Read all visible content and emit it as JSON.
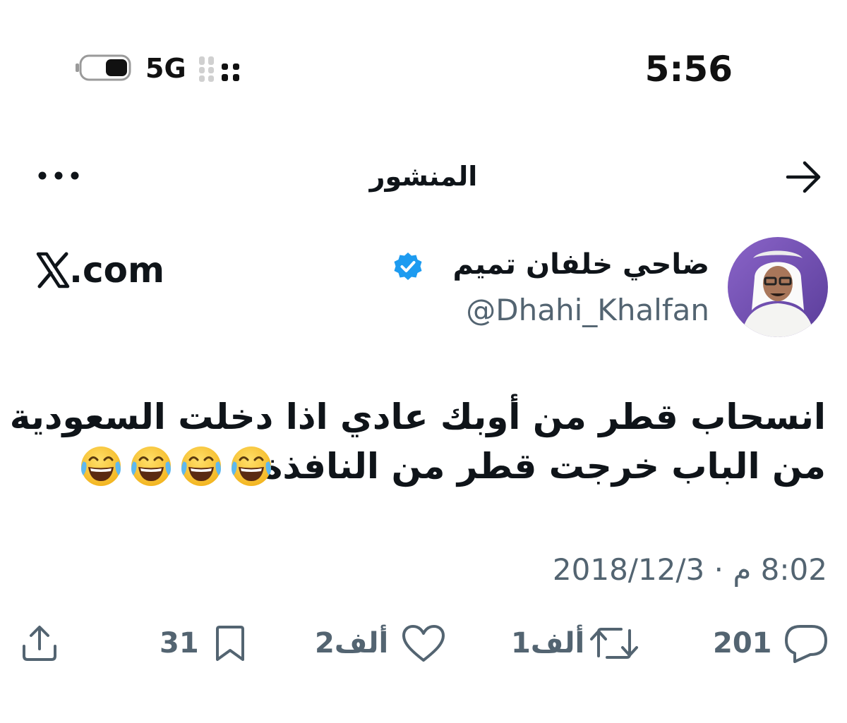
{
  "status_bar": {
    "time": "5:56",
    "network": "5G",
    "icons": [
      "battery-icon",
      "cellular-signal-icon"
    ]
  },
  "header": {
    "title": "المنشور",
    "back_icon": "arrow-right-icon",
    "more_icon": "ellipsis-icon"
  },
  "author": {
    "display_name": "ضاحي خلفان تميم",
    "handle": "@Dhahi_Khalfan",
    "verified_icon": "verified-badge-icon",
    "verified_color": "#1d9bf0"
  },
  "source": {
    "logo_icon": "x-logo-icon",
    "domain": ".com"
  },
  "post": {
    "lines": [
      "انسحاب قطر من أوبك عادي اذا دخلت السعودية",
      "من الباب خرجت قطر من النافذة."
    ],
    "emoji": "face-with-tears-of-joy-icon",
    "emoji_count": 4
  },
  "timestamp": "8:02 م · 2018/12/3",
  "actions": {
    "replies": "201",
    "reposts": "1ألف",
    "likes": "2ألف",
    "bookmarks": "31"
  },
  "colors": {
    "text": "#0f1419",
    "secondary": "#536471",
    "accent": "#1d9bf0"
  }
}
